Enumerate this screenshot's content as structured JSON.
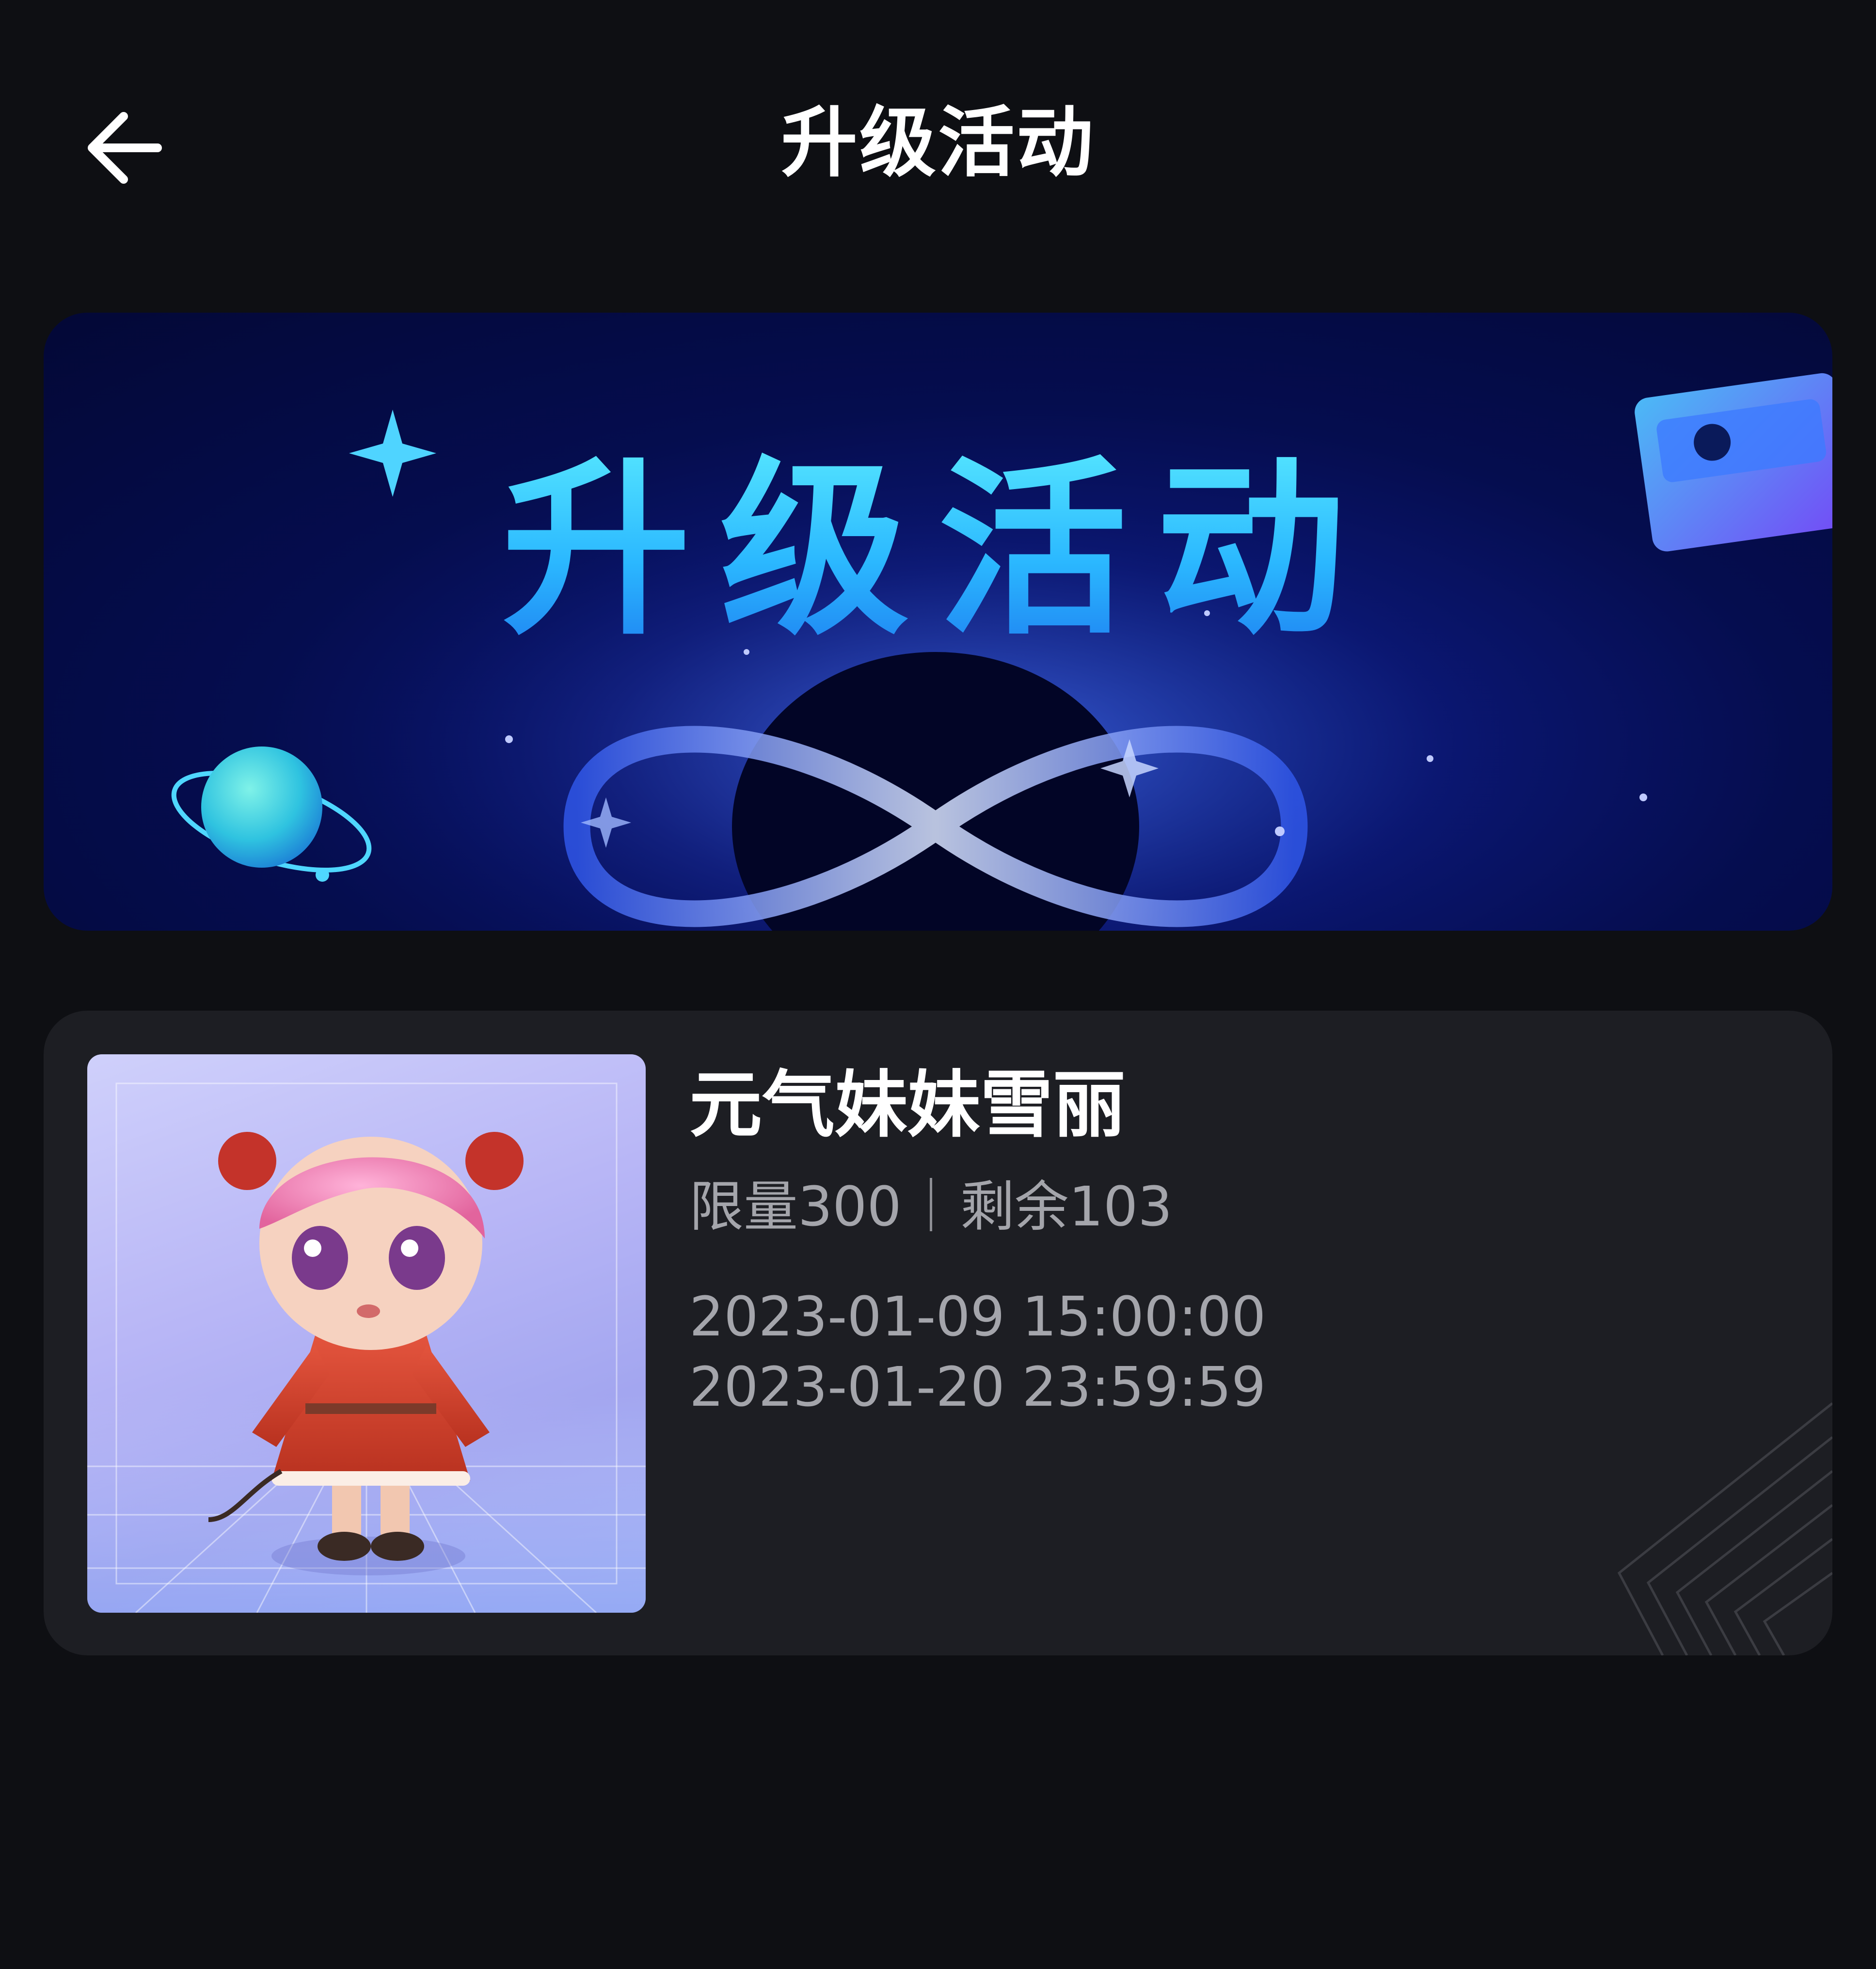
{
  "header": {
    "title": "升级活动",
    "back_icon": "arrow-left-icon"
  },
  "banner": {
    "title": "升级活动"
  },
  "activity_card": {
    "name": "元气妹妹雪丽",
    "limit_label": "限量300",
    "remaining_label": "剩余103",
    "start_time": "2023-01-09 15:00:00",
    "end_time": "2023-01-20 23:59:59"
  },
  "colors": {
    "background": "#0e0f13",
    "card": "#1d1e23",
    "secondary_text": "#a4a5ab",
    "banner_accent": "#2bb8ff"
  }
}
